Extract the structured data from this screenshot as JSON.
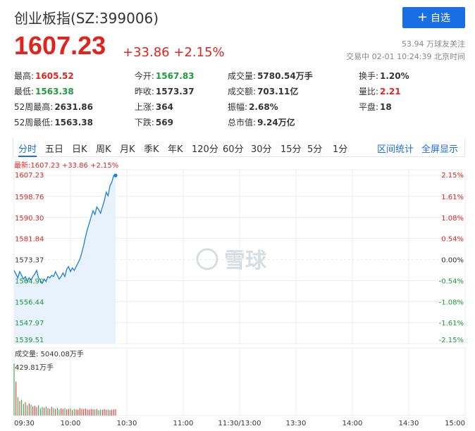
{
  "header": {
    "title": "创业板指(SZ:399006)",
    "add_label": "自选",
    "add_symbol": "+"
  },
  "price": {
    "current": "1607.23",
    "change": "+33.86",
    "change_pct": "+2.15%",
    "followers": "53.94 万球友关注",
    "status_time": "交易中 02-01 10:24:39 北京时间"
  },
  "quote": {
    "rows": [
      [
        {
          "label": "最高:",
          "value": "1605.52",
          "color": "up"
        },
        {
          "label": "今开:",
          "value": "1567.83",
          "color": "down"
        },
        {
          "label": "成交量:",
          "value": "5780.54万手",
          "color": ""
        },
        {
          "label": "换手:",
          "value": "1.20%",
          "color": ""
        }
      ],
      [
        {
          "label": "最低:",
          "value": "1563.38",
          "color": "down"
        },
        {
          "label": "昨收:",
          "value": "1573.37",
          "color": ""
        },
        {
          "label": "成交额:",
          "value": "703.11亿",
          "color": ""
        },
        {
          "label": "量比:",
          "value": "2.21",
          "color": "up"
        }
      ],
      [
        {
          "label": "52周最高:",
          "value": "2631.86",
          "color": ""
        },
        {
          "label": "上涨:",
          "value": "364",
          "color": ""
        },
        {
          "label": "振幅:",
          "value": "2.68%",
          "color": ""
        },
        {
          "label": "平盘:",
          "value": "18",
          "color": ""
        }
      ],
      [
        {
          "label": "52周最低:",
          "value": "1563.38",
          "color": ""
        },
        {
          "label": "下跌:",
          "value": "569",
          "color": ""
        },
        {
          "label": "总市值:",
          "value": "9.24万亿",
          "color": ""
        },
        {
          "label": "",
          "value": "",
          "color": ""
        }
      ]
    ]
  },
  "tabs": {
    "items": [
      "分时",
      "五日",
      "日K",
      "周K",
      "月K",
      "季K",
      "年K",
      "120分",
      "60分",
      "30分",
      "15分",
      "5分",
      "1分"
    ],
    "active": "分时",
    "right": [
      "区间统计",
      "全屏显示"
    ]
  },
  "chart_meta": {
    "latest_label": "最新:1607.23 +33.86 +2.15%",
    "volume_label": "成交量: 5040.08万手",
    "volume_max_label": "429.81万手",
    "watermark": "雪球",
    "colors": {
      "up": "#e0251f",
      "down": "#1e9b3a",
      "line": "#1a7ee3",
      "fill": "#e8f2fd",
      "grid": "#ececec"
    }
  },
  "chart_data": {
    "type": "line",
    "prev_close": 1573.37,
    "y_left_ticks": [
      "1607.23",
      "1598.76",
      "1590.30",
      "1581.84",
      "1573.37",
      "1564.90",
      "1556.44",
      "1547.97",
      "1539.51"
    ],
    "y_right_ticks": [
      "2.15%",
      "1.61%",
      "1.08%",
      "0.54%",
      "0.00%",
      "-0.54%",
      "-1.08%",
      "-1.61%",
      "-2.15%"
    ],
    "ylim": [
      1539.51,
      1607.23
    ],
    "x_ticks": [
      "09:30",
      "10:00",
      "10:30",
      "11:00",
      "11:30/13:00",
      "13:30",
      "14:00",
      "14:30",
      "15:00"
    ],
    "total_minutes": 240,
    "price_series": [
      1569.0,
      1567.5,
      1566.0,
      1568.5,
      1567.0,
      1565.5,
      1566.5,
      1564.5,
      1566.0,
      1565.0,
      1566.5,
      1567.5,
      1569.0,
      1566.0,
      1565.0,
      1563.8,
      1565.5,
      1564.5,
      1566.5,
      1566.0,
      1567.0,
      1566.5,
      1568.5,
      1567.0,
      1565.5,
      1566.5,
      1568.0,
      1566.5,
      1569.5,
      1570.5,
      1568.5,
      1570.0,
      1569.0,
      1570.5,
      1572.0,
      1573.5,
      1576.0,
      1579.0,
      1582.5,
      1585.5,
      1588.0,
      1590.5,
      1593.0,
      1591.5,
      1594.5,
      1593.5,
      1592.0,
      1594.5,
      1597.0,
      1600.5,
      1599.0,
      1603.0,
      1604.5,
      1607.2,
      1607.2
    ],
    "volume_series": [
      429.8,
      280,
      150,
      120,
      130,
      95,
      110,
      85,
      100,
      90,
      75,
      80,
      70,
      85,
      60,
      70,
      65,
      75,
      60,
      55,
      70,
      60,
      55,
      65,
      50,
      60,
      55,
      60,
      50,
      55,
      60,
      45,
      55,
      50,
      48,
      60,
      55,
      52,
      58,
      50,
      48,
      55,
      52,
      50,
      55,
      45,
      50,
      48,
      52,
      47,
      50,
      45,
      48,
      50,
      52
    ],
    "volume_up_flags": [
      0,
      1,
      0,
      1,
      0,
      0,
      1,
      0,
      1,
      0,
      1,
      1,
      1,
      0,
      0,
      0,
      1,
      0,
      1,
      0,
      1,
      0,
      1,
      0,
      0,
      1,
      1,
      0,
      1,
      1,
      0,
      1,
      0,
      1,
      1,
      1,
      1,
      1,
      1,
      1,
      1,
      1,
      1,
      0,
      1,
      0,
      0,
      1,
      1,
      1,
      0,
      1,
      1,
      1,
      1
    ]
  }
}
